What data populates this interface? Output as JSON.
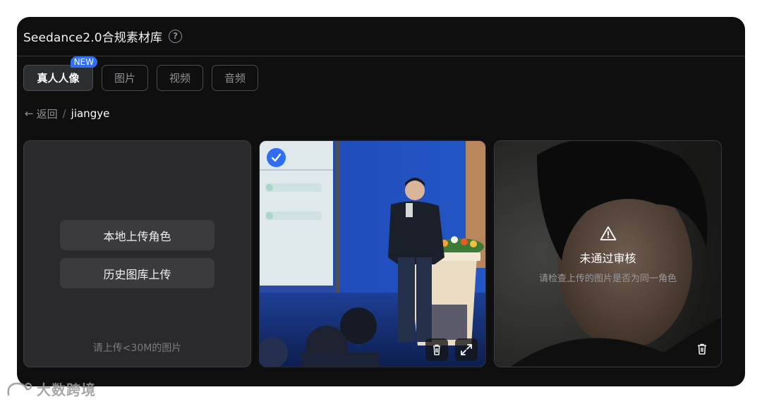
{
  "header": {
    "title": "Seedance2.0合规素材库"
  },
  "tabs": [
    {
      "label": "真人人像",
      "badge": "NEW",
      "active": true
    },
    {
      "label": "图片"
    },
    {
      "label": "视频"
    },
    {
      "label": "音频"
    }
  ],
  "breadcrumb": {
    "back_label": "返回",
    "separator": "/",
    "current": "jiangye"
  },
  "upload_card": {
    "local_upload_label": "本地上传角色",
    "history_upload_label": "历史图库上传",
    "hint": "请上传<30M的图片"
  },
  "photo_card": {
    "selected": true
  },
  "rejected_card": {
    "title": "未通过审核",
    "message": "请检查上传的图片是否为同一角色"
  },
  "watermark": {
    "text": "大数跨境"
  },
  "colors": {
    "accent": "#2f6ff0",
    "panel": "#0f0f10",
    "card": "#2a2a2d"
  }
}
